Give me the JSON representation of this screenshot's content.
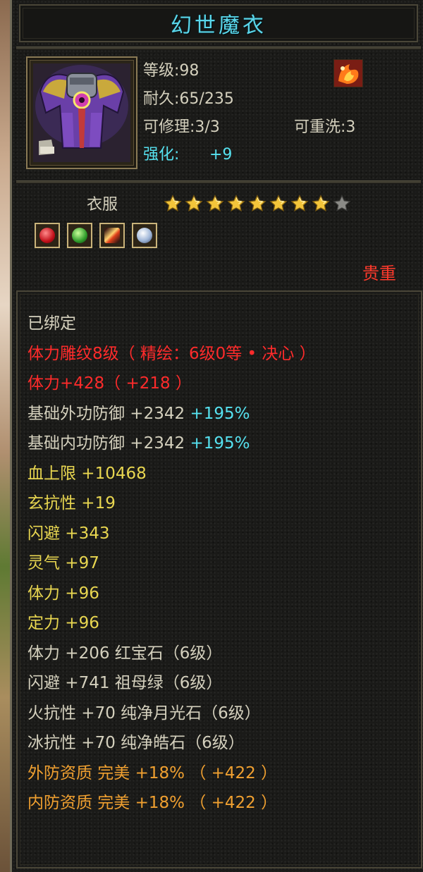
{
  "item": {
    "name": "幻世魔衣",
    "level_label": "等级:98",
    "durability_label": "耐久:65/235",
    "repair_label": "可修理:3/3",
    "rewash_label": "可重洗:3",
    "enhance_label": "强化:",
    "enhance_value": "+9",
    "type": "衣服",
    "stars_filled": 8,
    "stars_total": 9,
    "quality": "贵重",
    "gem_icons": [
      "ruby-gem-icon",
      "emerald-gem-icon",
      "moonstone-gem-icon",
      "diamond-gem-icon"
    ]
  },
  "attributes": [
    {
      "segments": [
        {
          "text": "已绑定",
          "color": "white"
        }
      ]
    },
    {
      "segments": [
        {
          "text": "体力雕纹8级（ 精绘：6级0等 • 决心 ）",
          "color": "red"
        }
      ]
    },
    {
      "segments": [
        {
          "text": "体力+428（ +218 ）",
          "color": "red"
        }
      ]
    },
    {
      "segments": [
        {
          "text": "基础外功防御  +2342 ",
          "color": "white"
        },
        {
          "text": "+195%",
          "color": "cyan"
        }
      ]
    },
    {
      "segments": [
        {
          "text": "基础内功防御  +2342 ",
          "color": "white"
        },
        {
          "text": "+195%",
          "color": "cyan"
        }
      ]
    },
    {
      "segments": [
        {
          "text": "血上限  +10468",
          "color": "yellow"
        }
      ]
    },
    {
      "segments": [
        {
          "text": "玄抗性  +19",
          "color": "yellow"
        }
      ]
    },
    {
      "segments": [
        {
          "text": "闪避  +343",
          "color": "yellow"
        }
      ]
    },
    {
      "segments": [
        {
          "text": "灵气  +97",
          "color": "yellow"
        }
      ]
    },
    {
      "segments": [
        {
          "text": "体力  +96",
          "color": "yellow"
        }
      ]
    },
    {
      "segments": [
        {
          "text": "定力  +96",
          "color": "yellow"
        }
      ]
    },
    {
      "segments": [
        {
          "text": "体力  +206  红宝石（6级）",
          "color": "white"
        }
      ]
    },
    {
      "segments": [
        {
          "text": "闪避  +741  祖母绿（6级）",
          "color": "white"
        }
      ]
    },
    {
      "segments": [
        {
          "text": "火抗性  +70  纯净月光石（6级）",
          "color": "white"
        }
      ]
    },
    {
      "segments": [
        {
          "text": "冰抗性  +70  纯净皓石（6级）",
          "color": "white"
        }
      ]
    },
    {
      "segments": [
        {
          "text": "外防资质    完美  +18% （ +422 ）",
          "color": "orange"
        }
      ]
    },
    {
      "segments": [
        {
          "text": "内防资质    完美  +18% （ +422 ）",
          "color": "orange"
        }
      ]
    }
  ],
  "colors": {
    "white": "#d4d0bd",
    "red": "#ff2b2b",
    "yellow": "#e8d650",
    "orange": "#f0a030",
    "cyan": "#56e2f0",
    "title": "#5ad6ea",
    "quality": "#ff3a2c"
  }
}
